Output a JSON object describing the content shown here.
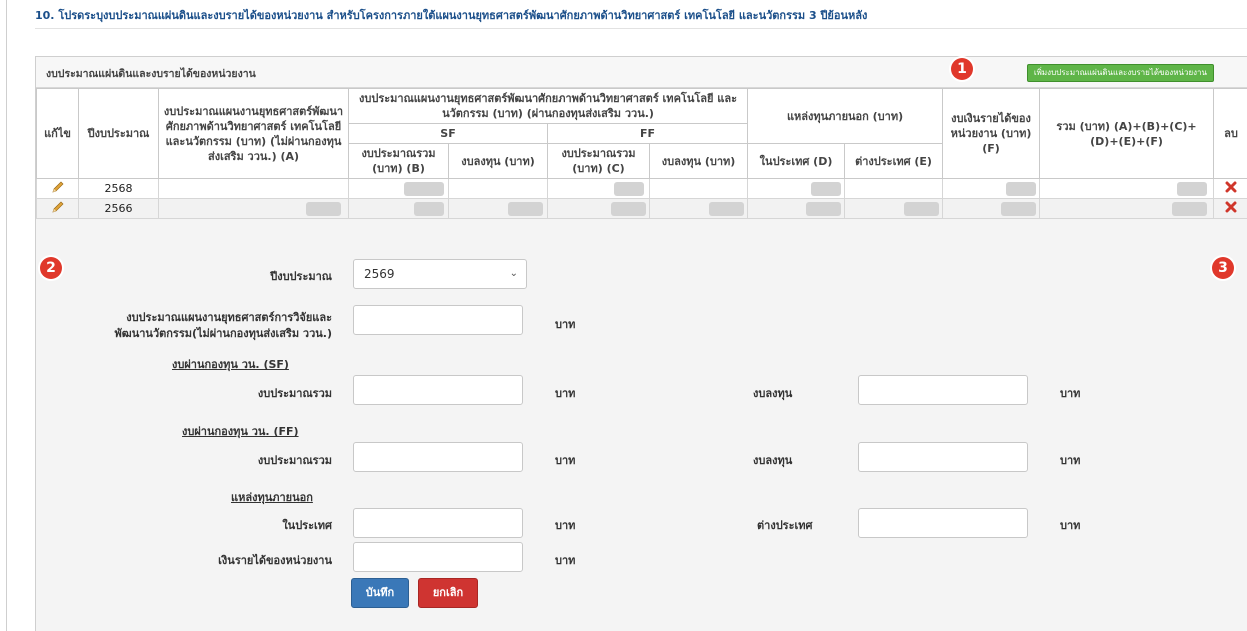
{
  "section_title": "10. โปรดระบุงบประมาณแผ่นดินและงบรายได้ของหน่วยงาน สำหรับโครงการภายใต้แผนงานยุทธศาสตร์พัฒนาศักยภาพด้านวิทยาศาสตร์ เทคโนโลยี และนวัตกรรม 3 ปีย้อนหลัง",
  "panel": {
    "title": "งบประมาณแผ่นดินและงบรายได้ของหน่วยงาน",
    "add_button": "เพิ่มงบประมาณแผ่นดินและงบรายได้ของหน่วยงาน"
  },
  "badges": [
    "1",
    "2",
    "3"
  ],
  "table": {
    "h_edit": "แก้ไข",
    "h_year": "ปีงบประมาณ",
    "h_a": "งบประมาณแผนงานยุทธศาสตร์พัฒนาศักยภาพด้านวิทยาศาสตร์ เทคโนโลยี และนวัตกรรม (บาท) (ไม่ผ่านกองทุนส่งเสริม ววน.) (A)",
    "h_stp": "งบประมาณแผนงานยุทธศาสตร์พัฒนาศักยภาพด้านวิทยาศาสตร์ เทคโนโลยี และนวัตกรรม (บาท) (ผ่านกองทุนส่งเสริม ววน.)",
    "h_sf": "SF",
    "h_ff": "FF",
    "h_sf_total": "งบประมาณรวม (บาท) (B)",
    "h_sf_invest": "งบลงทุน (บาท)",
    "h_ff_total": "งบประมาณรวม (บาท) (C)",
    "h_ff_invest": "งบลงทุน (บาท)",
    "h_external": "แหล่งทุนภายนอก (บาท)",
    "h_domestic": "ในประเทศ (D)",
    "h_foreign": "ต่างประเทศ (E)",
    "h_income": "งบเงินรายได้ของหน่วยงาน (บาท) (F)",
    "h_sum": "รวม (บาท) (A)+(B)+(C)+(D)+(E)+(F)",
    "h_delete": "ลบ",
    "rows": [
      {
        "year": "2568"
      },
      {
        "year": "2566"
      }
    ]
  },
  "form": {
    "year_label": "ปีงบประมาณ",
    "year_value": "2569",
    "strategy_label_1": "งบประมาณแผนงานยุทธศาสตร์การวิจัยและ",
    "strategy_label_2": "พัฒนานวัตกรรม(ไม่ผ่านกองทุนส่งเสริม ววน.)",
    "sf_heading": "งบผ่านกองทุน วน. (SF)",
    "ff_heading": "งบผ่านกองทุน วน. (FF)",
    "total_label": "งบประมาณรวม",
    "invest_label": "งบลงทุน",
    "external_heading": "แหล่งทุนภายนอก",
    "domestic_label": "ในประเทศ",
    "foreign_label": "ต่างประเทศ",
    "income_label": "เงินรายได้ของหน่วยงาน",
    "unit": "บาท",
    "save": "บันทึก",
    "cancel": "ยกเลิก"
  }
}
